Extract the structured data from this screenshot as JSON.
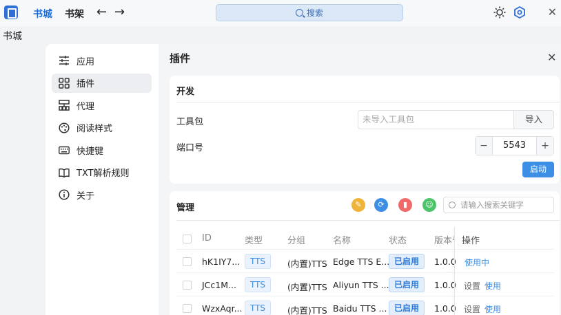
{
  "topbar": {
    "tabs": [
      {
        "label": "书城",
        "active": true
      },
      {
        "label": "书架",
        "active": false
      }
    ],
    "back_icon": "arrow-left-icon",
    "forward_icon": "arrow-right-icon",
    "search_placeholder": "搜索",
    "icons": [
      "sun-icon",
      "settings-icon",
      "close-icon"
    ]
  },
  "page": {
    "title": "书城"
  },
  "sidebar": {
    "items": [
      {
        "label": "应用",
        "icon": "sliders-icon",
        "active": false
      },
      {
        "label": "插件",
        "icon": "grid-icon",
        "active": true
      },
      {
        "label": "代理",
        "icon": "network-icon",
        "active": false
      },
      {
        "label": "阅读样式",
        "icon": "palette-icon",
        "active": false
      },
      {
        "label": "快捷键",
        "icon": "keyboard-icon",
        "active": false
      },
      {
        "label": "TXT解析规则",
        "icon": "book-icon",
        "active": false
      },
      {
        "label": "关于",
        "icon": "info-icon",
        "active": false
      }
    ]
  },
  "panel": {
    "title": "插件"
  },
  "dev": {
    "title": "开发",
    "toolkit_label": "工具包",
    "toolkit_placeholder": "未导入工具包",
    "import_label": "导入",
    "port_label": "端口号",
    "port_value": "5543",
    "minus": "−",
    "plus": "+",
    "start_label": "启动"
  },
  "mgmt": {
    "title": "管理",
    "search_placeholder": "请输入搜索关键字",
    "toolbar_icons": [
      {
        "name": "edit-icon",
        "color": "#f0b43c"
      },
      {
        "name": "refresh-icon",
        "color": "#3d8fe6"
      },
      {
        "name": "delete-icon",
        "color": "#f06a6a"
      },
      {
        "name": "smile-icon",
        "color": "#4cc46a"
      }
    ],
    "columns": [
      "ID",
      "类型",
      "分组",
      "名称",
      "状态",
      "版本号",
      "操作"
    ],
    "rows": [
      {
        "id": "hK1IY7...",
        "type": "TTS",
        "group": "(内置)TTS",
        "name": "Edge TTS E...",
        "status": "已启用",
        "version": "1.0.0",
        "op_set": "",
        "op_use": "使用中"
      },
      {
        "id": "JCc1M...",
        "type": "TTS",
        "group": "(内置)TTS",
        "name": "Aliyun TTS ...",
        "status": "已启用",
        "version": "1.0.0",
        "op_set": "设置",
        "op_use": "使用"
      },
      {
        "id": "WzxAqr...",
        "type": "TTS",
        "group": "(内置)TTS",
        "name": "Baidu TTS ...",
        "status": "已启用",
        "version": "1.0.0",
        "op_set": "设置",
        "op_use": "使用"
      }
    ]
  }
}
